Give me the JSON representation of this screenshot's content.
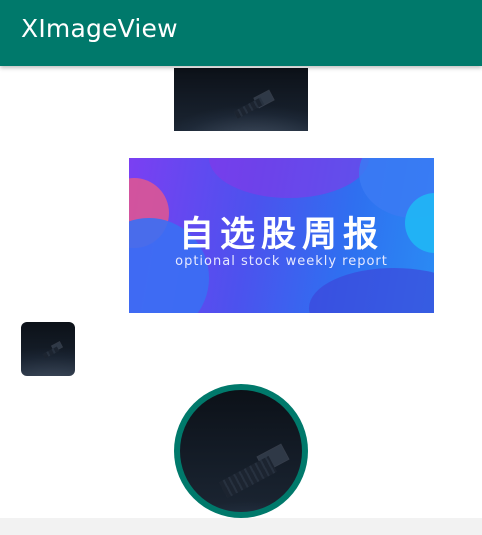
{
  "app_bar": {
    "title": "XImageView",
    "color": "#00796b"
  },
  "banner": {
    "title": "自选股周报",
    "subtitle": "optional stock weekly report"
  }
}
